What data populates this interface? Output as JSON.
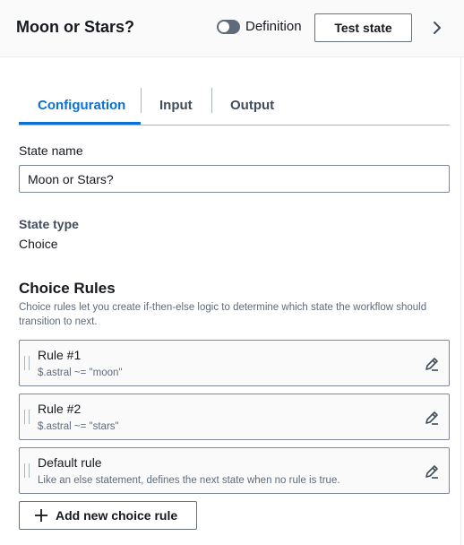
{
  "header": {
    "title": "Moon or Stars?",
    "toggle_label": "Definition",
    "toggle_on": false,
    "test_button": "Test state"
  },
  "tabs": [
    {
      "label": "Configuration",
      "active": true
    },
    {
      "label": "Input",
      "active": false
    },
    {
      "label": "Output",
      "active": false
    }
  ],
  "form": {
    "state_name_label": "State name",
    "state_name_value": "Moon or Stars?",
    "state_type_label": "State type",
    "state_type_value": "Choice"
  },
  "choice_rules": {
    "title": "Choice Rules",
    "description": "Choice rules let you create if-then-else logic to determine which state the workflow should transition to next.",
    "rules": [
      {
        "title": "Rule #1",
        "condition": "$.astral ~= \"moon\""
      },
      {
        "title": "Rule #2",
        "condition": "$.astral ~= \"stars\""
      },
      {
        "title": "Default rule",
        "condition": "Like an else statement, defines the next state when no rule is true."
      }
    ],
    "add_button": "Add new choice rule"
  },
  "colors": {
    "accent": "#0972d3",
    "text": "#16191f",
    "muted": "#5f6b7a",
    "border": "#7d8998"
  },
  "icons": [
    "toggle-switch",
    "chevron-right-icon",
    "drag-handle-icon",
    "edit-pencil-icon",
    "plus-icon"
  ]
}
